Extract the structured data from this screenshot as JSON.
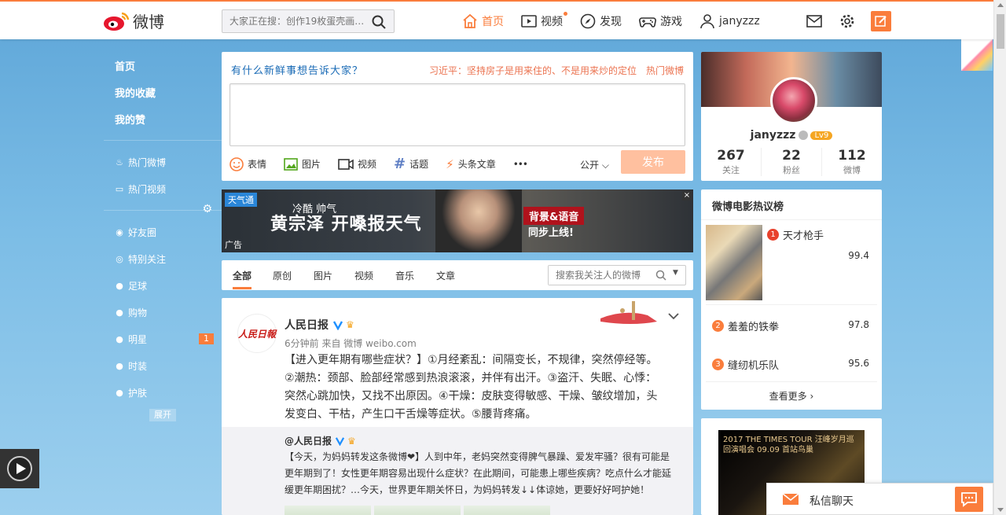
{
  "header": {
    "logo_text": "微博",
    "search_placeholder": "大家正在搜：创作19枚蛋壳画…",
    "nav": [
      {
        "label": "首页",
        "icon": "home-icon",
        "active": true
      },
      {
        "label": "视频",
        "icon": "video-icon"
      },
      {
        "label": "发现",
        "icon": "discover-icon"
      },
      {
        "label": "游戏",
        "icon": "game-icon"
      },
      {
        "label": "janyzzz",
        "icon": "user-icon"
      }
    ],
    "accent": "#fa7d3c"
  },
  "sidebar": {
    "items": [
      {
        "label": "首页"
      },
      {
        "label": "我的收藏"
      },
      {
        "label": "我的赞"
      },
      {
        "label": "热门微博",
        "icon": "fire-icon"
      },
      {
        "label": "热门视频",
        "icon": "video-icon"
      },
      {
        "label": "好友圈",
        "icon": "circle-icon"
      },
      {
        "label": "特别关注",
        "icon": "eye-icon"
      },
      {
        "label": "足球"
      },
      {
        "label": "购物"
      },
      {
        "label": "明星",
        "badge": "1"
      },
      {
        "label": "时装"
      },
      {
        "label": "护肤"
      }
    ],
    "expand_label": "展开"
  },
  "publisher": {
    "prompt": "有什么新鲜事想告诉大家？",
    "hot_text": "习近平：坚持房子是用来住的、不是用来炒的定位",
    "hot_link": "热门微博",
    "tools": [
      "表情",
      "图片",
      "视频",
      "话题",
      "头条文章"
    ],
    "more": "•••",
    "visibility": "公开",
    "submit": "发布"
  },
  "banner": {
    "weather_tag": "天气通",
    "slogan_small": "冷酷 帅气",
    "slogan": "黄宗泽 开嗓报天气",
    "tag1": "背景&语音",
    "tag2": "同步上线!",
    "ad_label": "广告",
    "close": "×"
  },
  "feed_tabs": {
    "tabs": [
      "全部",
      "原创",
      "图片",
      "视频",
      "音乐",
      "文章"
    ],
    "search_placeholder": "搜索我关注人的微博"
  },
  "post": {
    "avatar_text": "人民日報",
    "author": "人民日报",
    "meta": "6分钟前 来自 微博 weibo.com",
    "text": "【进入更年期有哪些症状？】①月经紊乱：间隔变长，不规律，突然停经等。②潮热：颈部、脸部经常感到热浪滚滚，并伴有出汗。③盗汗、失眠、心悸：突然心跳加快，又找不出原因。④干燥：皮肤变得敏感、干燥、皱纹增加，头发变白、干枯，产生口干舌燥等症状。⑤腰背疼痛。",
    "repost_author": "@人民日报",
    "repost_text": "【今天，为妈妈转发这条微博❤】人到中年，老妈突然变得脾气暴躁、爱发牢骚？很有可能是更年期到了！女性更年期容易出现什么症状？在此期间，可能患上哪些疾病？吃点什么才能延缓更年期困扰？…今天，世界更年期关怀日，为妈妈转发↓↓体谅她，更要好好呵护她！"
  },
  "profile": {
    "name": "janyzzz",
    "level": "Lv9",
    "stats": [
      {
        "num": "267",
        "label": "关注"
      },
      {
        "num": "22",
        "label": "粉丝"
      },
      {
        "num": "112",
        "label": "微博"
      }
    ]
  },
  "movies": {
    "title": "微博电影热议榜",
    "items": [
      {
        "rank": "1",
        "name": "天才枪手",
        "score": "99.4",
        "color": "#e8412c"
      },
      {
        "rank": "2",
        "name": "羞羞的铁拳",
        "score": "97.8",
        "color": "#fa7d3c"
      },
      {
        "rank": "3",
        "name": "缝纫机乐队",
        "score": "95.6",
        "color": "#fa7d3c"
      }
    ],
    "more": "查看更多"
  },
  "ad2": {
    "text": "2017 THE TIMES TOUR 汪峰岁月巡回演唱会 09.09 首站鸟巢"
  },
  "chat": {
    "label": "私信聊天"
  }
}
